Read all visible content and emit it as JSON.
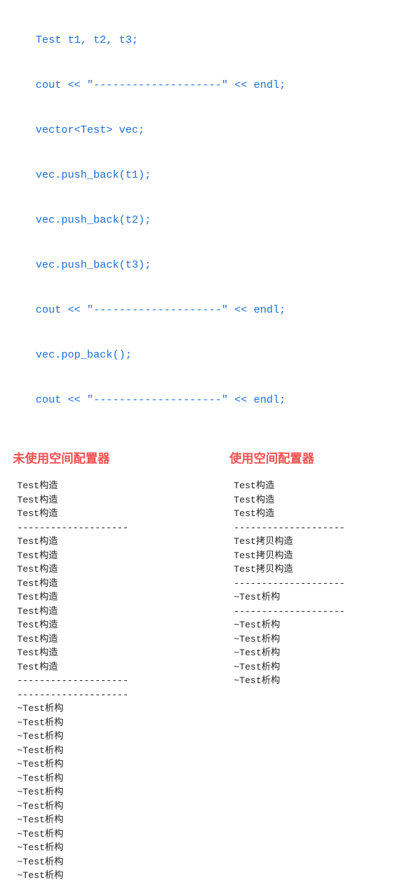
{
  "code": [
    "Test t1, t2, t3;",
    "cout << \"--------------------\" << endl;",
    "vector<Test> vec;",
    "vec.push_back(t1);",
    "vec.push_back(t2);",
    "vec.push_back(t3);",
    "cout << \"--------------------\" << endl;",
    "vec.pop_back();",
    "cout << \"--------------------\" << endl;"
  ],
  "left": {
    "title": "未使用空间配置器",
    "lines": [
      "Test构造",
      "Test构造",
      "Test构造",
      "--------------------",
      "Test构造",
      "Test构造",
      "Test构造",
      "Test构造",
      "Test构造",
      "Test构造",
      "Test构造",
      "Test构造",
      "Test构造",
      "Test构造",
      "--------------------",
      "--------------------",
      "~Test析构",
      "~Test析构",
      "~Test析构",
      "~Test析构",
      "~Test析构",
      "~Test析构",
      "~Test析构",
      "~Test析构",
      "~Test析构",
      "~Test析构",
      "~Test析构",
      "~Test析构",
      "~Test析构"
    ]
  },
  "right": {
    "title": "使用空间配置器",
    "lines": [
      "Test构造",
      "Test构造",
      "Test构造",
      "--------------------",
      "Test拷贝构造",
      "Test拷贝构造",
      "Test拷贝构造",
      "--------------------",
      "~Test析构",
      "--------------------",
      "~Test析构",
      "~Test析构",
      "~Test析构",
      "~Test析构",
      "~Test析构"
    ]
  }
}
